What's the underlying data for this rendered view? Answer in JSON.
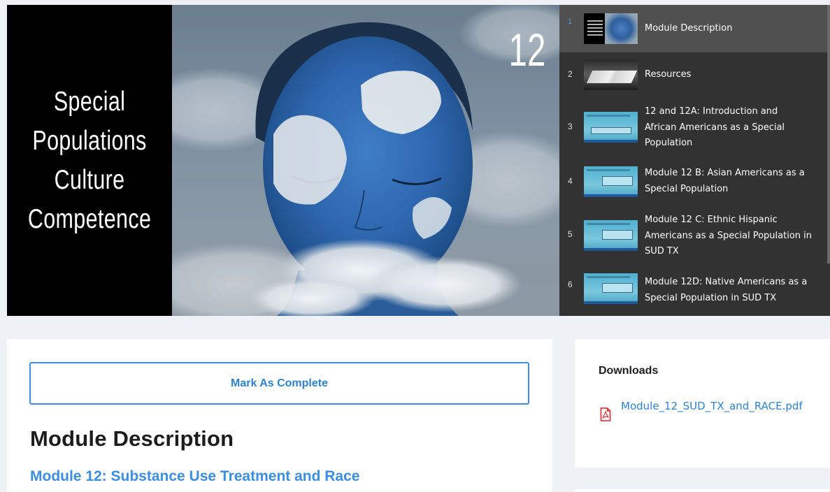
{
  "video": {
    "title_lines": [
      "Special",
      "Populations",
      "Culture",
      "Competence"
    ],
    "number": "12"
  },
  "playlist": [
    {
      "index": "1",
      "label": "Module Description",
      "thumb": "title-slide",
      "active": true
    },
    {
      "index": "2",
      "label": "Resources",
      "thumb": "book"
    },
    {
      "index": "3",
      "label": "12 and 12A: Introduction and African Americans as a Special Population",
      "thumb": "slide"
    },
    {
      "index": "4",
      "label": "Module 12 B: Asian Americans as a Special Population",
      "thumb": "slide"
    },
    {
      "index": "5",
      "label": "Module 12 C: Ethnic Hispanic Americans as a Special Population in SUD TX",
      "thumb": "slide"
    },
    {
      "index": "6",
      "label": "Module 12D: Native Americans as a Special Population in SUD TX",
      "thumb": "slide"
    }
  ],
  "main": {
    "mark_complete_label": "Mark As Complete",
    "page_title": "Module Description",
    "subtitle": "Module 12: Substance Use Treatment and Race"
  },
  "downloads": {
    "heading": "Downloads",
    "file_name": "Module_12_SUD_TX_and_RACE.pdf",
    "file_icon": "pdf-file-icon"
  },
  "colors": {
    "accent": "#3a8ee6",
    "playlist_bg": "#323232",
    "playlist_active": "#505050",
    "page_bg": "#eef1f5"
  }
}
